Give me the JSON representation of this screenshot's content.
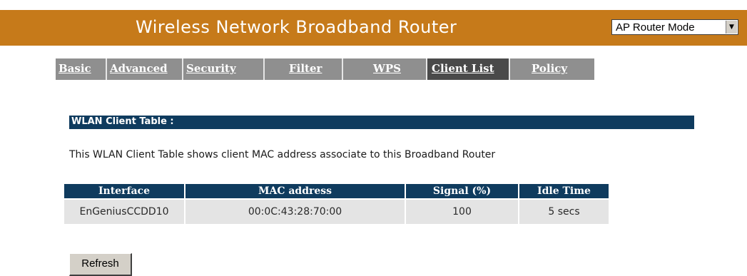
{
  "header": {
    "title": "Wireless Network Broadband Router",
    "mode_select": {
      "selected": "AP Router Mode",
      "arrow_icon": "triangle-down"
    }
  },
  "tabs": [
    {
      "label": "Basic",
      "active": false
    },
    {
      "label": "Advanced",
      "active": false
    },
    {
      "label": "Security",
      "active": false
    },
    {
      "label": "Filter",
      "active": false
    },
    {
      "label": "WPS",
      "active": false
    },
    {
      "label": "Client List",
      "active": true
    },
    {
      "label": "Policy",
      "active": false
    }
  ],
  "section": {
    "title": "WLAN Client Table :",
    "description": "This WLAN Client Table shows client MAC address associate to this Broadband Router"
  },
  "client_table": {
    "columns": [
      "Interface",
      "MAC address",
      "Signal (%)",
      "Idle Time"
    ],
    "rows": [
      [
        "EnGeniusCCDD10",
        "00:0C:43:28:70:00",
        "100",
        "5 secs"
      ]
    ]
  },
  "refresh_label": "Refresh",
  "colors": {
    "header_bg": "#c67a1a",
    "tab_bg": "#8f8f8f",
    "tab_active_bg": "#4a4a4a",
    "section_bg": "#0f3b5e",
    "cell_bg": "#e4e4e4"
  }
}
